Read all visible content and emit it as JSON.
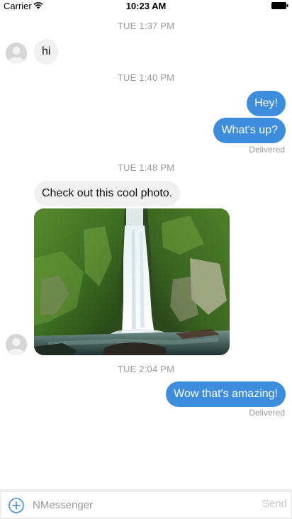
{
  "status_bar": {
    "carrier": "Carrier",
    "time": "10:23 AM",
    "wifi_icon": "wifi-icon",
    "battery_icon": "battery-icon"
  },
  "conversation": {
    "timestamps": [
      "TUE 1:37 PM",
      "TUE 1:40 PM",
      "TUE 1:48 PM",
      "TUE 2:04 PM"
    ],
    "messages": [
      {
        "direction": "incoming",
        "text": "hi"
      },
      {
        "direction": "outgoing",
        "text": "Hey!"
      },
      {
        "direction": "outgoing",
        "text": "What's up?",
        "status": "Delivered"
      },
      {
        "direction": "incoming",
        "text": "Check out this cool photo."
      },
      {
        "direction": "incoming",
        "media": "waterfall-photo"
      },
      {
        "direction": "outgoing",
        "text": "Wow that's amazing!",
        "status": "Delivered"
      }
    ]
  },
  "composer": {
    "placeholder": "NMessenger",
    "value": "",
    "send_label": "Send",
    "add_icon": "plus-circle-icon"
  },
  "colors": {
    "outgoing_bubble": "#3d8ddc",
    "incoming_bubble": "#f1f1f1",
    "timestamp_text": "#9a9a9a",
    "send_disabled": "#c7c7c7"
  }
}
